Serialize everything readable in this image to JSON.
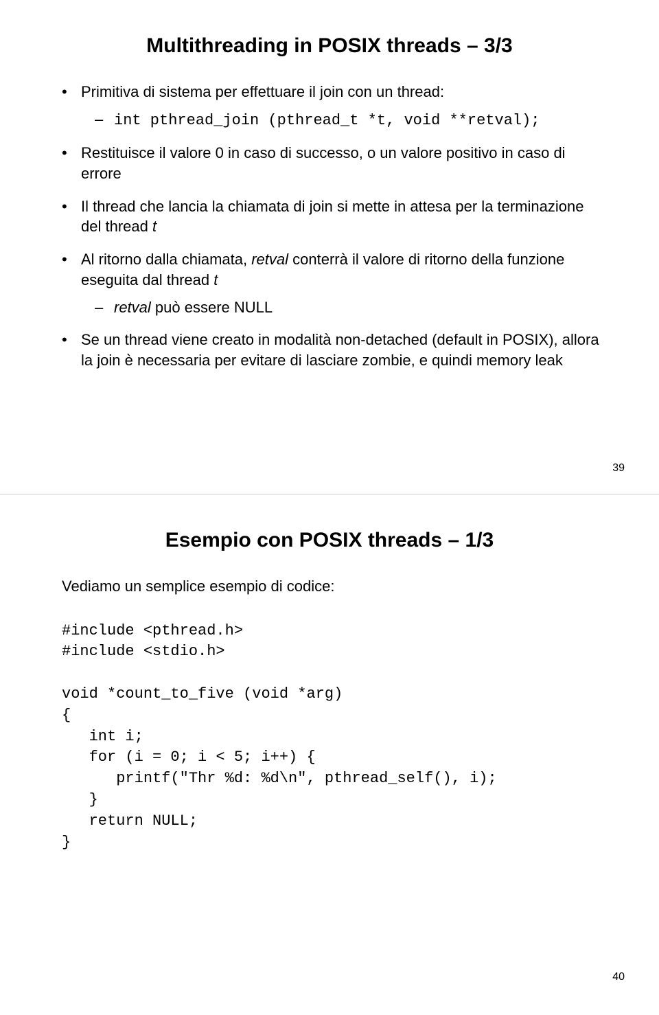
{
  "slide1": {
    "title": "Multithreading in POSIX threads – 3/3",
    "bullets": {
      "b1": "Primitiva di sistema per effettuare il join con un thread:",
      "b1_code": "int pthread_join (pthread_t *t, void **retval);",
      "b2": "Restituisce il valore 0 in caso di successo, o un valore positivo in caso di errore",
      "b3_a": "Il thread che lancia la chiamata di join si mette in attesa per la terminazione del thread ",
      "b3_t": "t",
      "b4_a": "Al ritorno dalla chiamata, ",
      "b4_r": "retval",
      "b4_b": " conterrà il valore di ritorno della funzione eseguita dal thread ",
      "b4_t": "t",
      "b4_sub_r": "retval",
      "b4_sub_txt": " può essere NULL",
      "b5": "Se un thread viene creato in modalità non-detached (default in POSIX), allora la join è necessaria per evitare di lasciare zombie, e quindi memory leak"
    },
    "pagenum": "39"
  },
  "slide2": {
    "title": "Esempio con POSIX threads – 1/3",
    "intro": "Vediamo un semplice esempio di codice:",
    "code": "#include <pthread.h>\n#include <stdio.h>\n\nvoid *count_to_five (void *arg)\n{\n   int i;\n   for (i = 0; i < 5; i++) {\n      printf(\"Thr %d: %d\\n\", pthread_self(), i);\n   }\n   return NULL;\n}",
    "pagenum": "40"
  }
}
